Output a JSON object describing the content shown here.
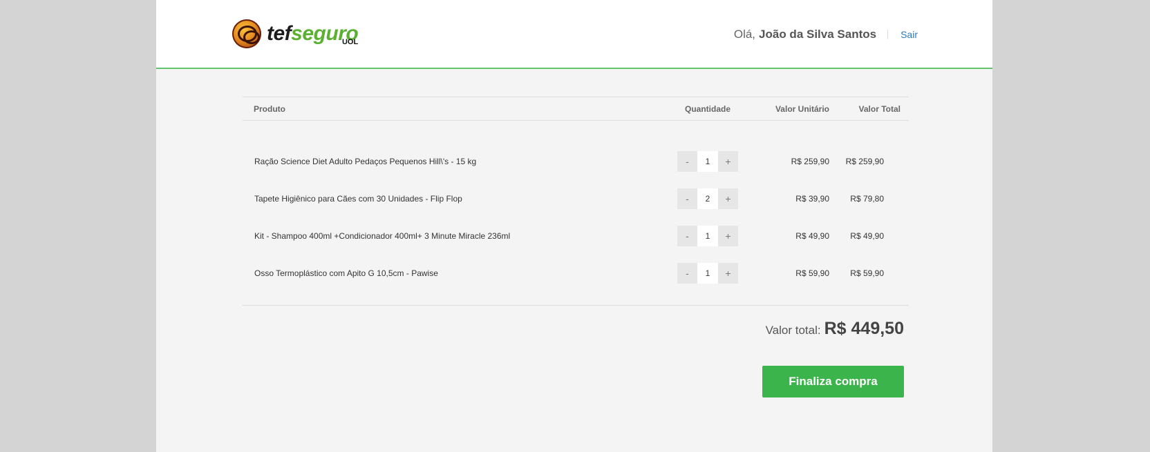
{
  "brand": {
    "logo_tef": "tef",
    "logo_seguro": "seguro",
    "logo_sub": "UOL",
    "colors": {
      "accent": "#3bb44c",
      "header_border": "#5fc46a",
      "link": "#2a7ac2"
    }
  },
  "header": {
    "greeting": "Olá,",
    "user_name": "João da Silva Santos",
    "logout_label": "Sair"
  },
  "table": {
    "columns": {
      "product": "Produto",
      "quantity": "Quantidade",
      "unit_price": "Valor Unitário",
      "total_price": "Valor Total"
    },
    "rows": [
      {
        "product": "Ração Science Diet Adulto Pedaços Pequenos Hill\\'s - 15 kg",
        "qty": "1",
        "unit": "R$ 259,90",
        "total": "R$ 259,90"
      },
      {
        "product": "Tapete Higiênico para Cães com 30 Unidades - Flip Flop",
        "qty": "2",
        "unit": "R$ 39,90",
        "total": "R$ 79,80"
      },
      {
        "product": "Kit  - Shampoo 400ml +Condicionador 400ml+ 3 Minute Miracle 236ml",
        "qty": "1",
        "unit": "R$ 49,90",
        "total": "R$ 49,90"
      },
      {
        "product": "Osso Termoplástico com Apito G 10,5cm - Pawise",
        "qty": "1",
        "unit": "R$ 59,90",
        "total": "R$ 59,90"
      }
    ],
    "decrement_label": "-",
    "increment_label": "+"
  },
  "summary": {
    "label": "Valor total:",
    "value": "R$ 449,50"
  },
  "checkout": {
    "label": "Finaliza compra"
  }
}
